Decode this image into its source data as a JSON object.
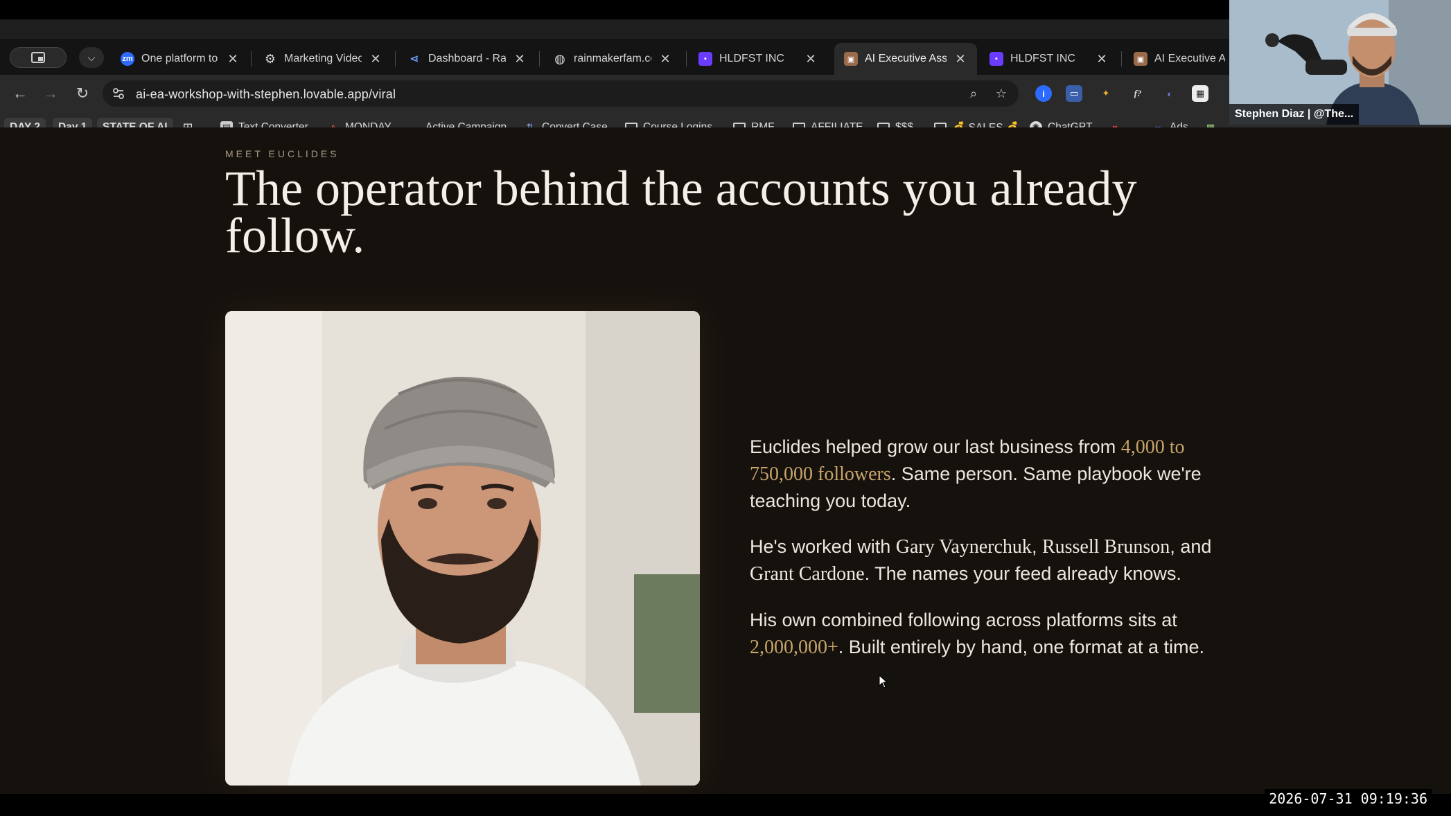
{
  "tabs": [
    {
      "title": "One platform to c",
      "favicon": "zoom-icon",
      "color": "#2d6bff",
      "active": false
    },
    {
      "title": "Marketing Video",
      "favicon": "gear-icon",
      "color": "#444444",
      "active": false
    },
    {
      "title": "Dashboard - Rain",
      "favicon": "share-icon",
      "color": "#3b7bff",
      "active": false
    },
    {
      "title": "rainmakerfam.co",
      "favicon": "globe-icon",
      "color": "#555555",
      "active": false
    },
    {
      "title": "HLDFST INC",
      "favicon": "app-icon",
      "color": "#6a3cff",
      "active": false
    },
    {
      "title": "AI Executive Assi",
      "favicon": "page-icon",
      "color": "#9a6a4a",
      "active": true
    },
    {
      "title": "HLDFST INC",
      "favicon": "app-icon",
      "color": "#6a3cff",
      "active": false
    },
    {
      "title": "AI Executive Ass",
      "favicon": "page-icon",
      "color": "#9a6a4a",
      "active": false
    }
  ],
  "address_bar": {
    "url": "ai-ea-workshop-with-stephen.lovable.app/viral"
  },
  "bookmarks": [
    {
      "label": "DAY 2",
      "type": "pill"
    },
    {
      "label": "Day 1",
      "type": "pill"
    },
    {
      "label": "STATE OF AI",
      "type": "pill"
    },
    {
      "label": "Text Converter",
      "type": "link"
    },
    {
      "label": "MONDAY",
      "type": "link"
    },
    {
      "label": "Active Campaign",
      "type": "link"
    },
    {
      "label": "Convert Case",
      "type": "link"
    },
    {
      "label": "Course Logins",
      "type": "folder"
    },
    {
      "label": "RMF",
      "type": "folder"
    },
    {
      "label": "AFFILIATE",
      "type": "folder"
    },
    {
      "label": "$$$",
      "type": "folder"
    },
    {
      "label": "💰 SALES 💰",
      "type": "folder"
    },
    {
      "label": "ChatGPT",
      "type": "link"
    },
    {
      "label": "Ads",
      "type": "link"
    }
  ],
  "webcam": {
    "label": "Stephen Diaz | @The..."
  },
  "page": {
    "eyebrow": "MEET EUCLIDES",
    "headline": "The operator behind the accounts you already follow.",
    "p1": {
      "before": "Euclides helped grow our last business from ",
      "highlight": "4,000 to 750,000 followers",
      "after": ". Same person. Same playbook we're teaching you today."
    },
    "p2": {
      "before": "He's worked with ",
      "name1": "Gary Vaynerchuk",
      "sep1": ", ",
      "name2": "Russell Brunson",
      "sep2": ", and ",
      "name3": "Grant Cardone",
      "after": ". The names your feed already knows."
    },
    "p3": {
      "before": "His own combined following across platforms sits at ",
      "highlight": "2,000,000+",
      "after": ". Built entirely by hand, one format at a time."
    }
  },
  "timestamp": "2026-07-31  09:19:36"
}
